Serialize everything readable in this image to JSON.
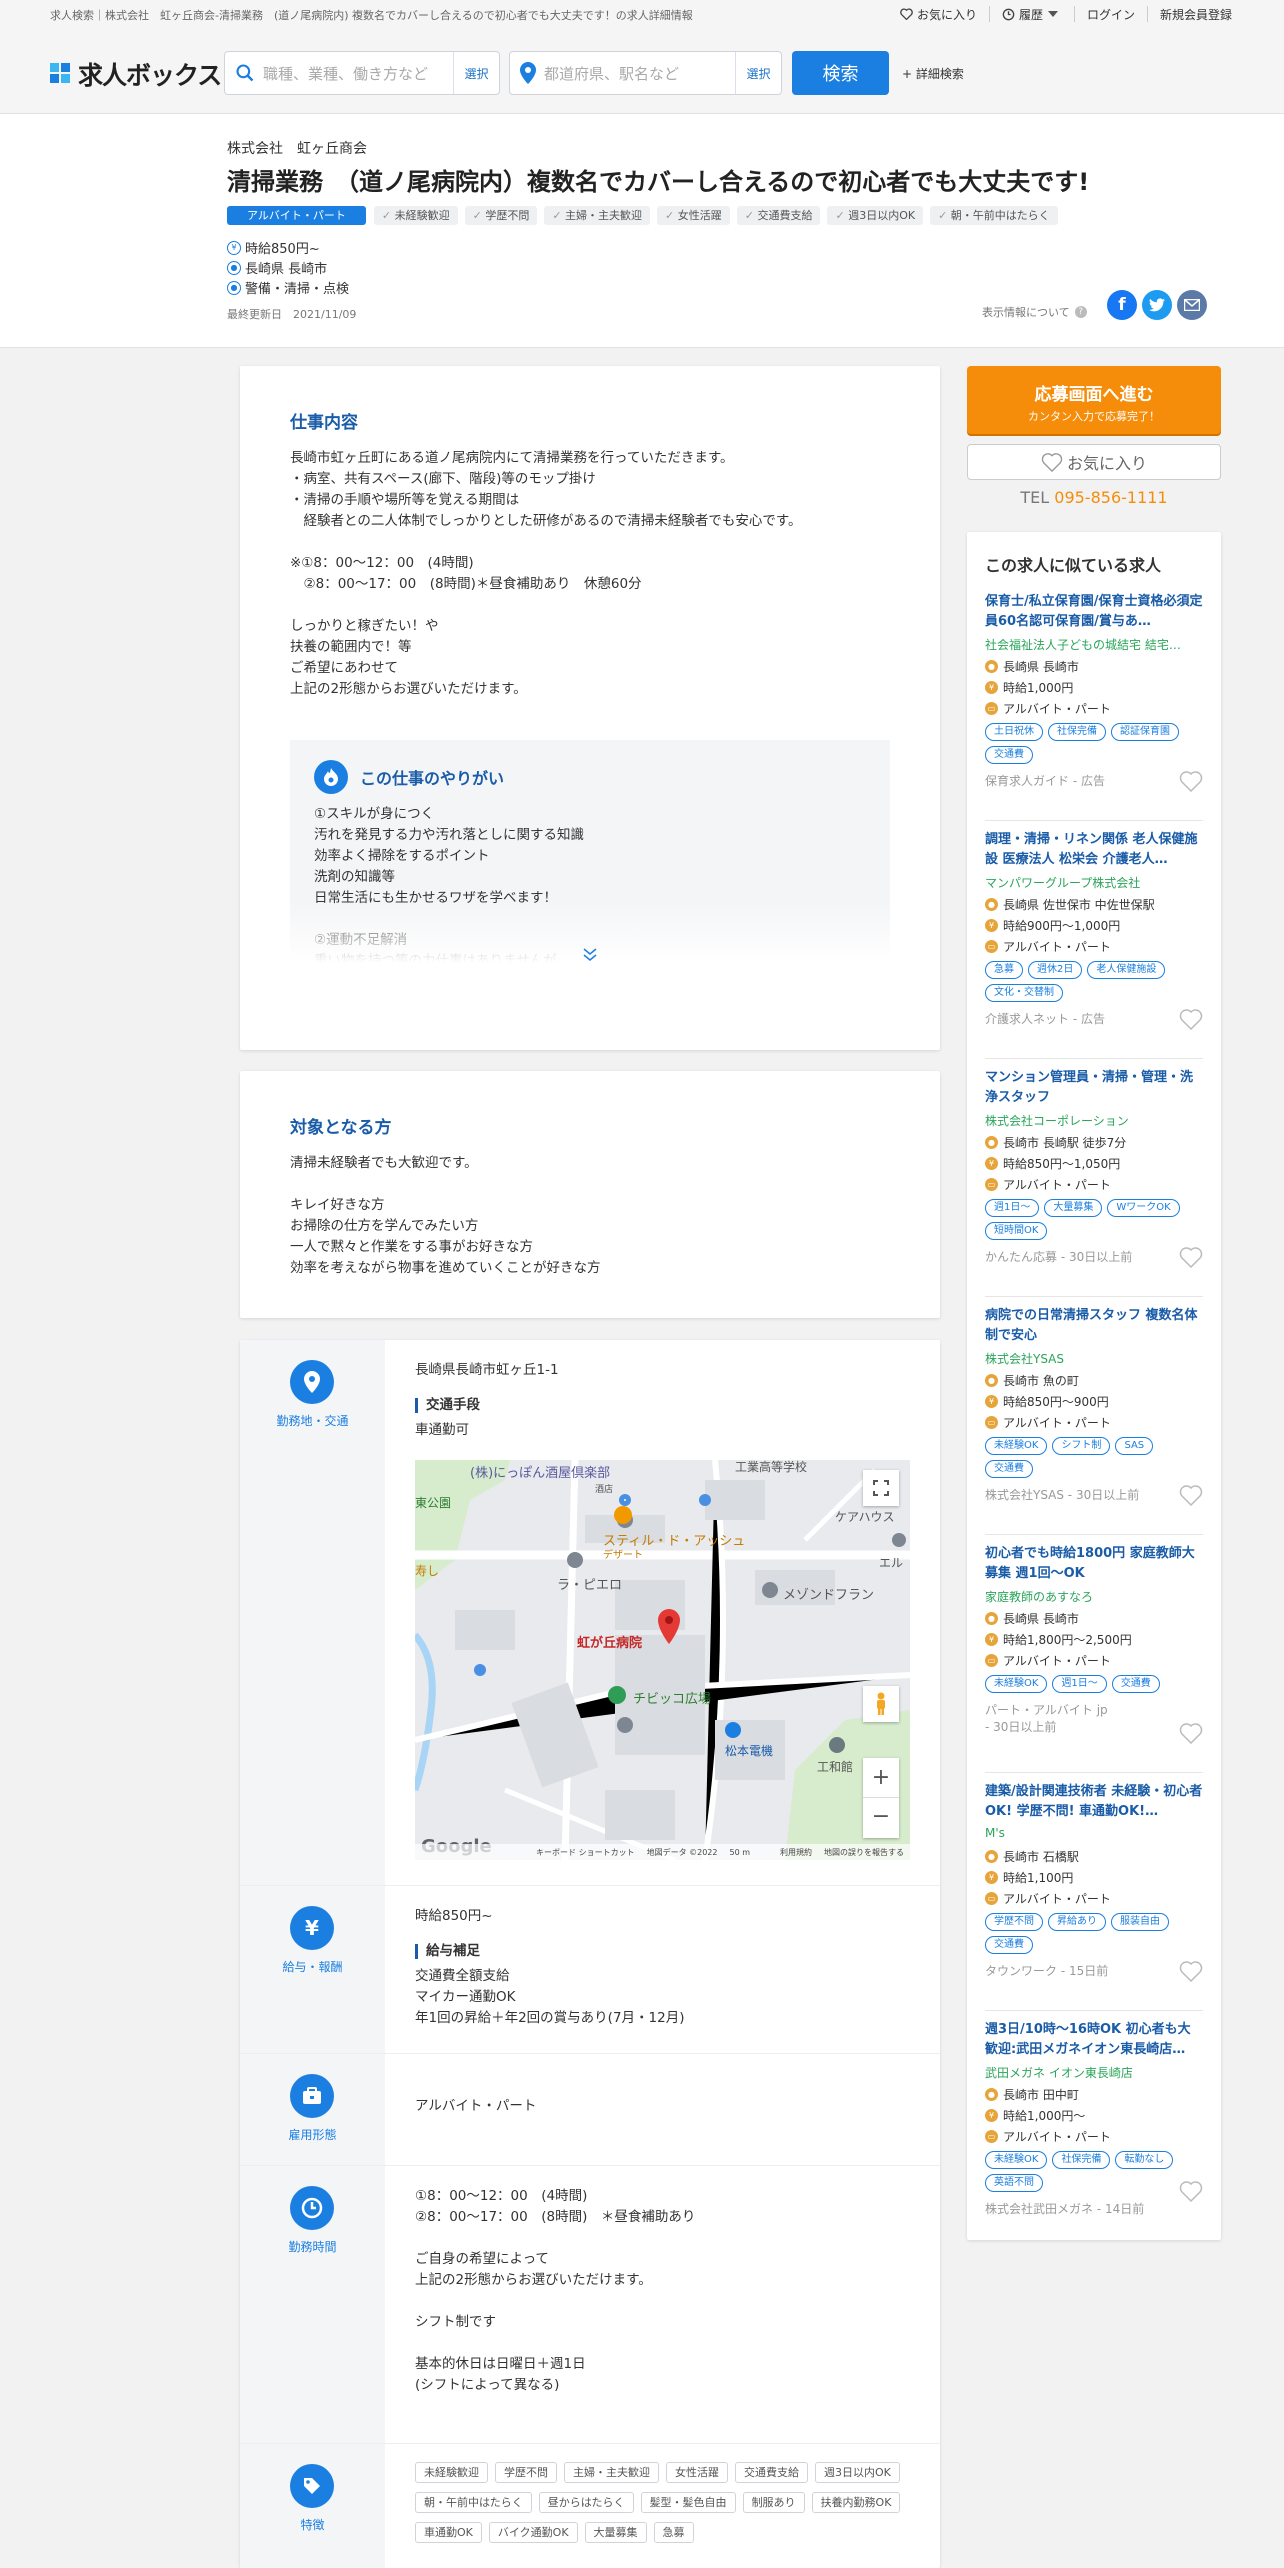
{
  "header": {
    "breadcrumb": "求人検索｜株式会社　虹ヶ丘商会-清掃業務　(道ノ尾病院内) 複数名でカバーし合えるので初心者でも大丈夫です！の求人詳細情報",
    "links": {
      "favorite": "お気に入り",
      "history": "履歴",
      "login": "ログイン",
      "register": "新規会員登録"
    },
    "logo": "求人ボックス",
    "job_search": {
      "placeholder": "職種、業種、働き方など",
      "select": "選択"
    },
    "area_search": {
      "placeholder": "都道府県、駅名など",
      "select": "選択"
    },
    "search_button": "検索",
    "advanced": "+ 詳細検索"
  },
  "job": {
    "company": "株式会社　虹ヶ丘商会",
    "title": "清掃業務　（道ノ尾病院内）複数名でカバーし合えるので初心者でも大丈夫です!",
    "employment_tag": "アルバイト・パート",
    "tags": [
      "未経験歓迎",
      "学歴不問",
      "主婦・主夫歓迎",
      "女性活躍",
      "交通費支給",
      "週3日以内OK",
      "朝・午前中はたらく"
    ],
    "wage": "時給850円~",
    "location": "長崎県 長崎市",
    "category": "警備・清掃・点検",
    "updated": "最終更新日　2021/11/09",
    "display_info": "表示情報について"
  },
  "work": {
    "title": "仕事内容",
    "body": "長崎市虹ヶ丘町にある道ノ尾病院内にて清掃業務を行っていただきます。\n・病室、共有スペース(廊下、階段)等のモップ掛け\n・清掃の手順や場所等を覚える期間は\n　経験者との二人体制でしっかりとした研修があるので清掃未経験者でも安心です。\n\n※①8：00～12：00　(4時間)\n　②8：00～17：00　(8時間)＊昼食補助あり　休憩60分\n\nしっかりと稼ぎたい！や\n扶養の範囲内で！等\nご希望にあわせて\n上記の2形態からお選びいただけます。",
    "yarigai_title": "この仕事のやりがい",
    "yarigai_body": "①スキルが身につく\n汚れを発見する力や汚れ落としに関する知識\n効率よく掃除をするポイント\n洗剤の知識等\n日常生活にも生かせるワザを学べます！\n\n②運動不足解消\n重い物を持つ等の力仕事はありませんが"
  },
  "target": {
    "title": "対象となる方",
    "body": "清掃未経験者でも大歓迎です。\n\nキレイ好きな方\nお掃除の仕方を学んでみたい方\n一人で黙々と作業をする事がお好きな方\n効率を考えながら物事を進めていくことが好きな方"
  },
  "details": {
    "location_label": "勤務地・交通",
    "address": "長崎県長崎市虹ヶ丘1-1",
    "transport_head": "交通手段",
    "transport": "車通勤可",
    "map": {
      "labels": [
        "(株)にっぽん酒屋倶楽部",
        "工業高等学校",
        "東公園",
        "スティル・ド・アッシュ",
        "デザート",
        "ケアハウス",
        "ラ・ピエロ",
        "メゾンドフラン",
        "エル",
        "寿し",
        "虹が丘病院",
        "チビッコ広場",
        "松本電機",
        "工和館",
        "酒店"
      ],
      "footer": [
        "キーボード ショートカット",
        "地図データ ©2022",
        "50 m",
        "利用規約",
        "地図の誤りを報告する"
      ],
      "google": "Google",
      "zoom_in": "+",
      "zoom_out": "−"
    },
    "salary_label": "給与・報酬",
    "salary": "時給850円~",
    "salary_head": "給与補足",
    "salary_note": "交通費全額支給\nマイカー通勤OK\n年1回の昇給＋年2回の賞与あり(7月・12月)",
    "type_label": "雇用形態",
    "type": "アルバイト・パート",
    "hours_label": "勤務時間",
    "hours": "①8：00～12：00　(4時間)\n②8：00～17：00　(8時間)　＊昼食補助あり\n\nご自身の希望によって\n上記の2形態からお選びいただけます。\n\nシフト制です\n\n基本的休日は日曜日＋週1日\n(シフトによって異なる)",
    "feature_label": "特徴",
    "features": [
      "未経験歓迎",
      "学歴不問",
      "主婦・主夫歓迎",
      "女性活躍",
      "交通費支給",
      "週3日以内OK",
      "朝・午前中はたらく",
      "昼からはたらく",
      "髪型・髪色自由",
      "制服あり",
      "扶養内勤務OK",
      "車通勤OK",
      "バイク通勤OK",
      "大量募集",
      "急募"
    ]
  },
  "sidebar": {
    "apply_main": "応募画面へ進む",
    "apply_sub": "カンタン入力で応募完了！",
    "favorite": "お気に入り",
    "tel_label": "TEL ",
    "tel_number": "095-856-1111",
    "similar_title": "この求人に似ている求人",
    "jobs": [
      {
        "title": "保育士/私立保育園/保育士資格必須定員60名認可保育園/賞与あ…",
        "company": "社会福祉法人子どもの城結宅 結宅…",
        "location": "長崎県 長崎市",
        "wage": "時給1,000円",
        "type": "アルバイト・パート",
        "tags": [
          "土日祝休",
          "社保完備",
          "認証保育園",
          "交通費"
        ],
        "source": "保育求人ガイド - 広告"
      },
      {
        "title": "調理・清掃・リネン関係 老人保健施設 医療法人 松栄会 介護老人…",
        "company": "マンパワーグループ株式会社",
        "location": "長崎県 佐世保市 中佐世保駅",
        "wage": "時給900円～1,000円",
        "type": "アルバイト・パート",
        "tags": [
          "急募",
          "週休2日",
          "老人保健施設",
          "文化・交替制"
        ],
        "source": "介護求人ネット - 広告"
      },
      {
        "title": "マンション管理員・清掃・管理・洗浄スタッフ",
        "company": "株式会社コーポレーション",
        "location": "長崎市 長崎駅 徒歩7分",
        "wage": "時給850円～1,050円",
        "type": "アルバイト・パート",
        "tags": [
          "週1日～",
          "大量募集",
          "WワークOK",
          "短時間OK"
        ],
        "source": "かんたん応募 - 30日以上前"
      },
      {
        "title": "病院での日常清掃スタッフ 複数名体制で安心",
        "company": "株式会社YSAS",
        "location": "長崎市 魚の町",
        "wage": "時給850円～900円",
        "type": "アルバイト・パート",
        "tags": [
          "未経験OK",
          "シフト制",
          "SAS",
          "交通費"
        ],
        "source": "株式会社YSAS - 30日以上前"
      },
      {
        "title": "初心者でも時給1800円 家庭教師大募集 週1回～OK",
        "company": "家庭教師のあすなろ",
        "location": "長崎県 長崎市",
        "wage": "時給1,800円～2,500円",
        "type": "アルバイト・パート",
        "tags": [
          "未経験OK",
          "週1日～",
          "交通費"
        ],
        "source": "パート・アルバイト jp\n- 30日以上前"
      },
      {
        "title": "建築/設計関連技術者 未経験・初心者OK! 学歴不問! 車通勤OK!…",
        "company": "M's",
        "location": "長崎市 石橋駅",
        "wage": "時給1,100円",
        "type": "アルバイト・パート",
        "tags": [
          "学歴不問",
          "昇給あり",
          "服装自由",
          "交通費"
        ],
        "source": "タウンワーク - 15日前"
      },
      {
        "title": "週3日/10時～16時OK 初心者も大歓迎:武田メガネイオン東長崎店…",
        "company": "武田メガネ イオン東長崎店",
        "location": "長崎市 田中町",
        "wage": "時給1,000円～",
        "type": "アルバイト・パート",
        "tags": [
          "未経験OK",
          "社保完備",
          "転勤なし",
          "英語不問"
        ],
        "source": "株式会社武田メガネ - 14日前"
      }
    ]
  },
  "colors": {
    "primary": "#1a7fe0",
    "heading": "#1a5ca8",
    "apply": "#f58d0a",
    "company_green": "#2aa55a"
  }
}
